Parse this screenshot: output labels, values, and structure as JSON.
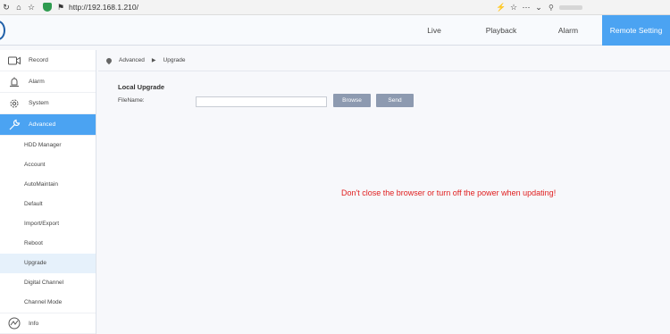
{
  "browser": {
    "url": "http://192.168.1.210/",
    "icons": [
      "back-icon",
      "home-icon",
      "star-icon",
      "shield-icon",
      "site-info-icon",
      "bolt-icon",
      "favorite-icon",
      "more-icon",
      "chevron-down-icon",
      "search-icon"
    ]
  },
  "header": {
    "nav": [
      {
        "label": "Live"
      },
      {
        "label": "Playback"
      },
      {
        "label": "Alarm"
      },
      {
        "label": "Remote Setting",
        "active": true
      }
    ],
    "accent_color": "#4ba3f2"
  },
  "sidebar": {
    "main_items": [
      {
        "label": "Record",
        "icon": "camera-icon"
      },
      {
        "label": "Alarm",
        "icon": "alarm-icon"
      },
      {
        "label": "System",
        "icon": "gear-icon"
      },
      {
        "label": "Advanced",
        "icon": "wrench-icon",
        "active": true
      },
      {
        "label": "Info",
        "icon": "chart-icon"
      }
    ],
    "sub_items": [
      {
        "label": "HDD Manager"
      },
      {
        "label": "Account"
      },
      {
        "label": "AutoMaintain"
      },
      {
        "label": "Default"
      },
      {
        "label": "Import/Export"
      },
      {
        "label": "Reboot"
      },
      {
        "label": "Upgrade",
        "selected": true
      },
      {
        "label": "Digital Channel"
      },
      {
        "label": "Channel Mode"
      }
    ]
  },
  "breadcrumb": [
    "Advanced",
    "Upgrade"
  ],
  "content": {
    "section_title": "Local Upgrade",
    "filename_label": "FileName:",
    "filename_value": "",
    "browse_label": "Browse",
    "send_label": "Send",
    "warning": "Don't close the browser or turn off the power when updating!",
    "warning_color": "#e02020"
  }
}
